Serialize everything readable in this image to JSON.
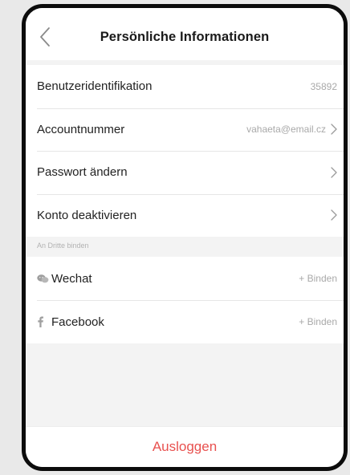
{
  "header": {
    "title": "Persönliche Informationen"
  },
  "account_rows": [
    {
      "label": "Benutzeridentifikation",
      "value": "35892"
    },
    {
      "label": "Accountnummer",
      "value": "vahaeta@email.cz"
    },
    {
      "label": "Passwort ändern",
      "value": ""
    },
    {
      "label": "Konto deaktivieren",
      "value": ""
    }
  ],
  "third_party": {
    "section_label": "An Dritte binden",
    "items": [
      {
        "label": "Wechat",
        "action": "+ Binden",
        "icon": "wechat-icon"
      },
      {
        "label": "Facebook",
        "action": "+ Binden",
        "icon": "facebook-icon"
      }
    ]
  },
  "footer": {
    "logout_label": "Ausloggen"
  },
  "colors": {
    "logout": "#e8514f",
    "muted": "#a9a9a9",
    "background": "#f3f3f3"
  }
}
